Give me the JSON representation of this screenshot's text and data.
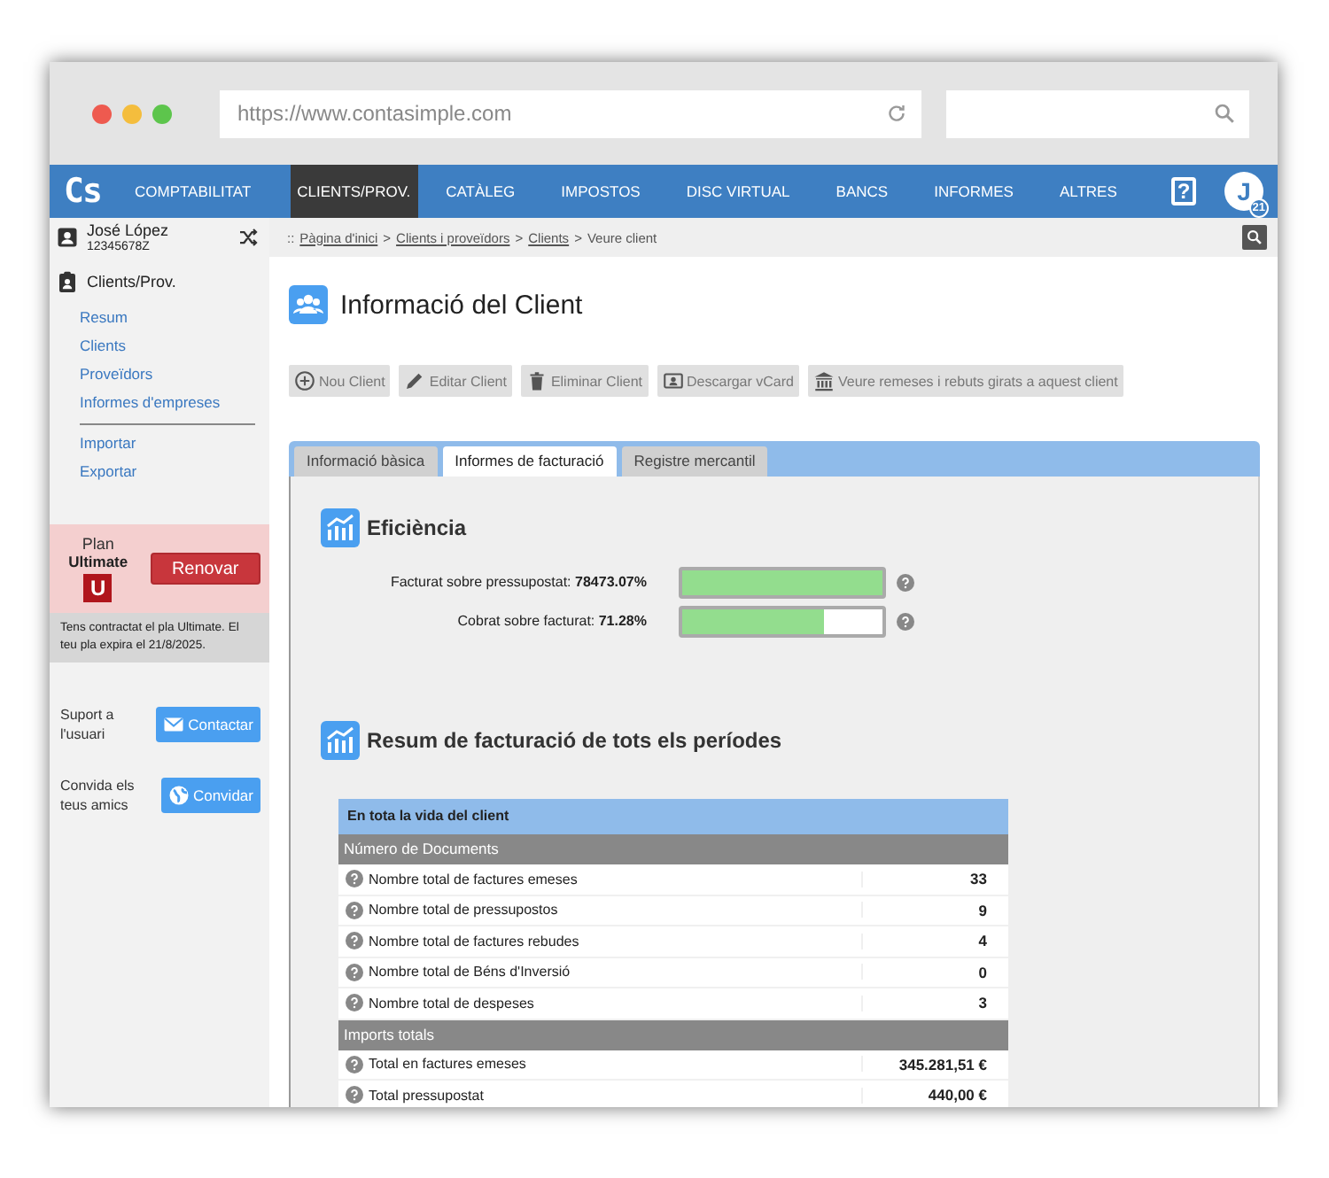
{
  "browser": {
    "url": "https://www.contasimple.com"
  },
  "nav": {
    "logo": "Cs",
    "items": [
      {
        "label": "COMPTABILITAT",
        "selected": false
      },
      {
        "label": "CLIENTS/PROV.",
        "selected": true
      },
      {
        "label": "CATÀLEG",
        "selected": false
      },
      {
        "label": "IMPOSTOS",
        "selected": false
      },
      {
        "label": "DISC VIRTUAL",
        "selected": false
      },
      {
        "label": "BANCS",
        "selected": false
      },
      {
        "label": "INFORMES",
        "selected": false
      },
      {
        "label": "ALTRES",
        "selected": false
      }
    ],
    "help": "?",
    "avatar": {
      "initial": "J",
      "badge": "21"
    }
  },
  "user": {
    "name": "José López",
    "id": "12345678Z"
  },
  "breadcrumb": {
    "prefix": "::",
    "separator": ">",
    "items": [
      {
        "label": "Pàgina d'inici",
        "kind": "link"
      },
      {
        "label": "Clients i proveïdors",
        "kind": "link"
      },
      {
        "label": "Clients",
        "kind": "link"
      },
      {
        "label": "Veure client",
        "kind": "current"
      }
    ]
  },
  "sidebar": {
    "section": "Clients/Prov.",
    "groups": [
      [
        "Resum",
        "Clients",
        "Proveïdors",
        "Informes d'empreses"
      ],
      [
        "Importar",
        "Exportar"
      ]
    ]
  },
  "plan": {
    "label": "Plan",
    "name": "Ultimate",
    "badge": "U",
    "button": "Renovar",
    "note": "Tens contractat el pla Ultimate. El teu pla expira el 21/8/2025."
  },
  "promos": [
    {
      "text": "Suport a l'usuari",
      "button": "Contactar",
      "kind": "mail"
    },
    {
      "text": "Convida els teus amics",
      "button": "Convidar",
      "kind": "globe"
    }
  ],
  "page_title": "Informació del Client",
  "toolbar": [
    {
      "label": "Nou Client",
      "kind": "add"
    },
    {
      "label": "Editar Client",
      "kind": "edit"
    },
    {
      "label": "Eliminar Client",
      "kind": "delete"
    },
    {
      "label": "Descargar vCard",
      "kind": "vcard"
    },
    {
      "label": "Veure remeses i rebuts girats a aquest client",
      "kind": "bank"
    }
  ],
  "tabs": [
    {
      "label": "Informació bàsica",
      "selected": false
    },
    {
      "label": "Informes de facturació",
      "selected": true
    },
    {
      "label": "Registre mercantil",
      "selected": false
    }
  ],
  "efficiency": {
    "title": "Eficiència",
    "meters": [
      {
        "label": "Facturat sobre pressupostat: **78473.07%**",
        "level": 1
      },
      {
        "label": "Cobrat sobre facturat: **71.28%**",
        "level": 0.71
      }
    ]
  },
  "summary": {
    "title": "Resum de facturació de tots els períodes",
    "header": "En tota la vida del client",
    "sections": [
      {
        "title": "Número de Documents",
        "rows": [
          {
            "label": "Nombre total de factures emeses",
            "value": "33"
          },
          {
            "label": "Nombre total de pressupostos",
            "value": "9"
          },
          {
            "label": "Nombre total de factures rebudes",
            "value": "4"
          },
          {
            "label": "Nombre total de Béns d'Inversió",
            "value": "0"
          },
          {
            "label": "Nombre total de despeses",
            "value": "3"
          }
        ]
      },
      {
        "title": "Imports totals",
        "rows": [
          {
            "label": "Total en factures emeses",
            "value": "345.281,51 €"
          },
          {
            "label": "Total pressupostat",
            "value": "440,00 €"
          }
        ]
      }
    ]
  }
}
